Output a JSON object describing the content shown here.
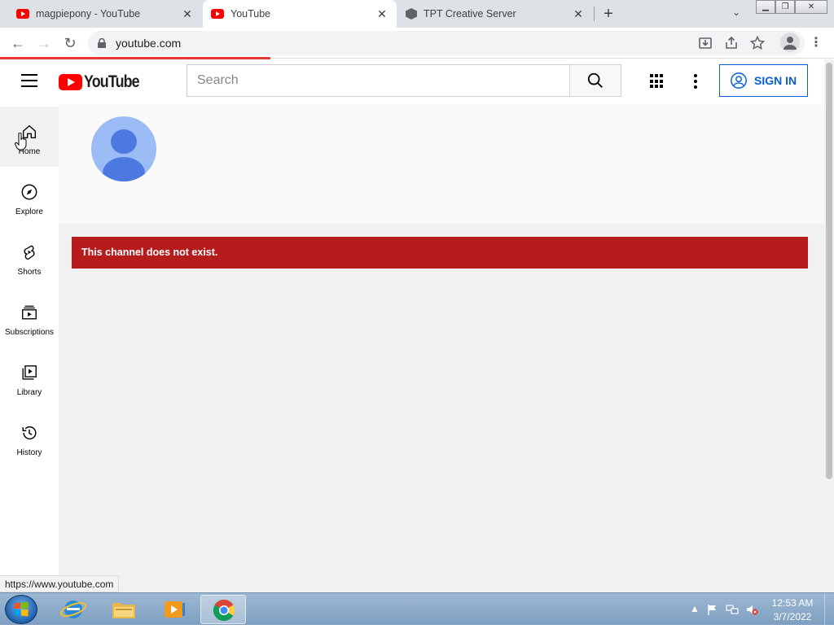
{
  "browser": {
    "tabs": [
      {
        "title": "magpiepony - YouTube",
        "favicon": "youtube-favicon"
      },
      {
        "title": "YouTube",
        "favicon": "youtube-favicon",
        "active": true
      },
      {
        "title": "TPT Creative Server",
        "favicon": "cube-favicon"
      }
    ],
    "url": "youtube.com",
    "status_url": "https://www.youtube.com"
  },
  "youtube": {
    "logo_text": "YouTube",
    "search_placeholder": "Search",
    "sign_in_label": "SIGN IN",
    "sidebar": [
      {
        "label": "Home",
        "icon": "home-icon",
        "active": true
      },
      {
        "label": "Explore",
        "icon": "compass-icon"
      },
      {
        "label": "Shorts",
        "icon": "shorts-icon"
      },
      {
        "label": "Subscriptions",
        "icon": "subscriptions-icon"
      },
      {
        "label": "Library",
        "icon": "library-icon"
      },
      {
        "label": "History",
        "icon": "history-icon"
      }
    ],
    "error_message": "This channel does not exist.",
    "colors": {
      "brand_red": "#ff0000",
      "error_red": "#b71c1c",
      "link_blue": "#065fd4"
    }
  },
  "taskbar": {
    "apps": [
      "internet-explorer-icon",
      "file-explorer-icon",
      "media-player-icon",
      "chrome-icon"
    ],
    "time": "12:53 AM",
    "date": "3/7/2022"
  }
}
